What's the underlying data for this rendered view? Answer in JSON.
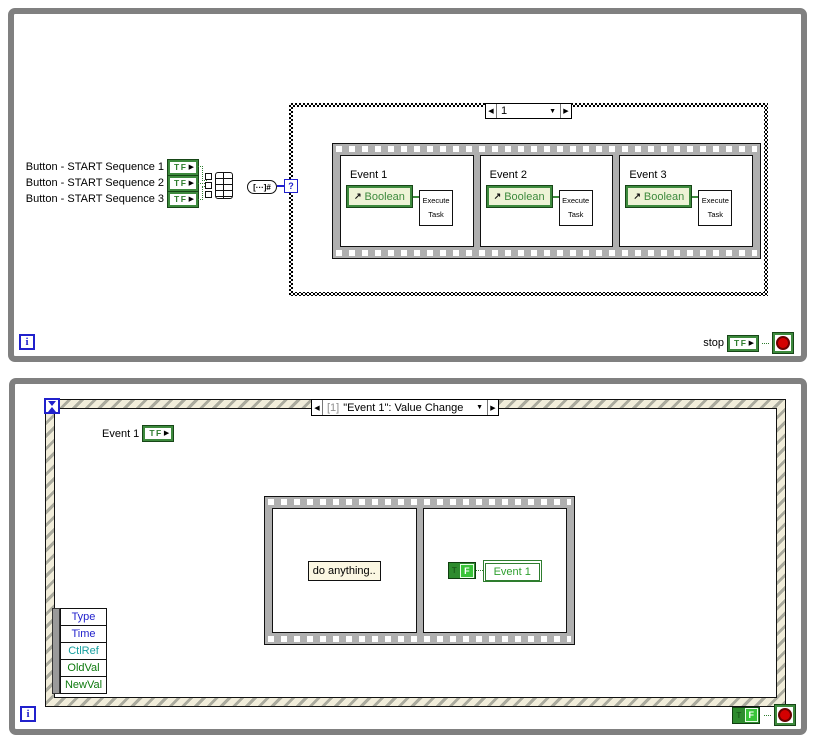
{
  "top_panel": {
    "controls": [
      {
        "label": "Button - START Sequence 1",
        "terminal": "TF"
      },
      {
        "label": "Button - START Sequence 2",
        "terminal": "TF"
      },
      {
        "label": "Button - START Sequence 3",
        "terminal": "TF"
      }
    ],
    "array_to_number_label": "[···]#",
    "case_selector": {
      "value": "1",
      "terminal": "?"
    },
    "frames": [
      {
        "title": "Event 1",
        "local": "Boolean",
        "subvi": "Execute Task"
      },
      {
        "title": "Event 2",
        "local": "Boolean",
        "subvi": "Execute Task"
      },
      {
        "title": "Event 3",
        "local": "Boolean",
        "subvi": "Execute Task"
      }
    ],
    "iteration": "i",
    "stop": {
      "label": "stop",
      "terminal": "TF"
    }
  },
  "bottom_panel": {
    "event_selector": {
      "prefix": "[1]",
      "label": "\"Event 1\": Value Change"
    },
    "event_source": {
      "label": "Event 1",
      "terminal": "TF"
    },
    "event_data": [
      "Type",
      "Time",
      "CtlRef",
      "OldVal",
      "NewVal"
    ],
    "frames": [
      {
        "note": "do anything.."
      },
      {
        "constant": {
          "t": "T",
          "f": "F"
        },
        "local": "Event 1"
      }
    ],
    "iteration": "i",
    "stop_constant": {
      "t": "T",
      "f": "F"
    }
  },
  "icons": {
    "prev": "◀",
    "next": "▶",
    "dropdown": "▼",
    "out_arrow": "▶",
    "local_var_arrow": "↗",
    "timeout": "hourglass",
    "stop_button": "red-circle"
  },
  "colors": {
    "loop_border": "#808080",
    "terminal_green": "#2E7D2E",
    "bright_green": "#39C439",
    "local_bg": "#EEF3D6",
    "wire_blue": "#2020D0",
    "label_blue": "#2222CC",
    "ctlref_teal": "#18A0A0",
    "value_green": "#0E7A0E",
    "stop_red": "#D40000",
    "note_bg": "#FBF7E2",
    "stripe_cream": "#F1EDDA"
  }
}
